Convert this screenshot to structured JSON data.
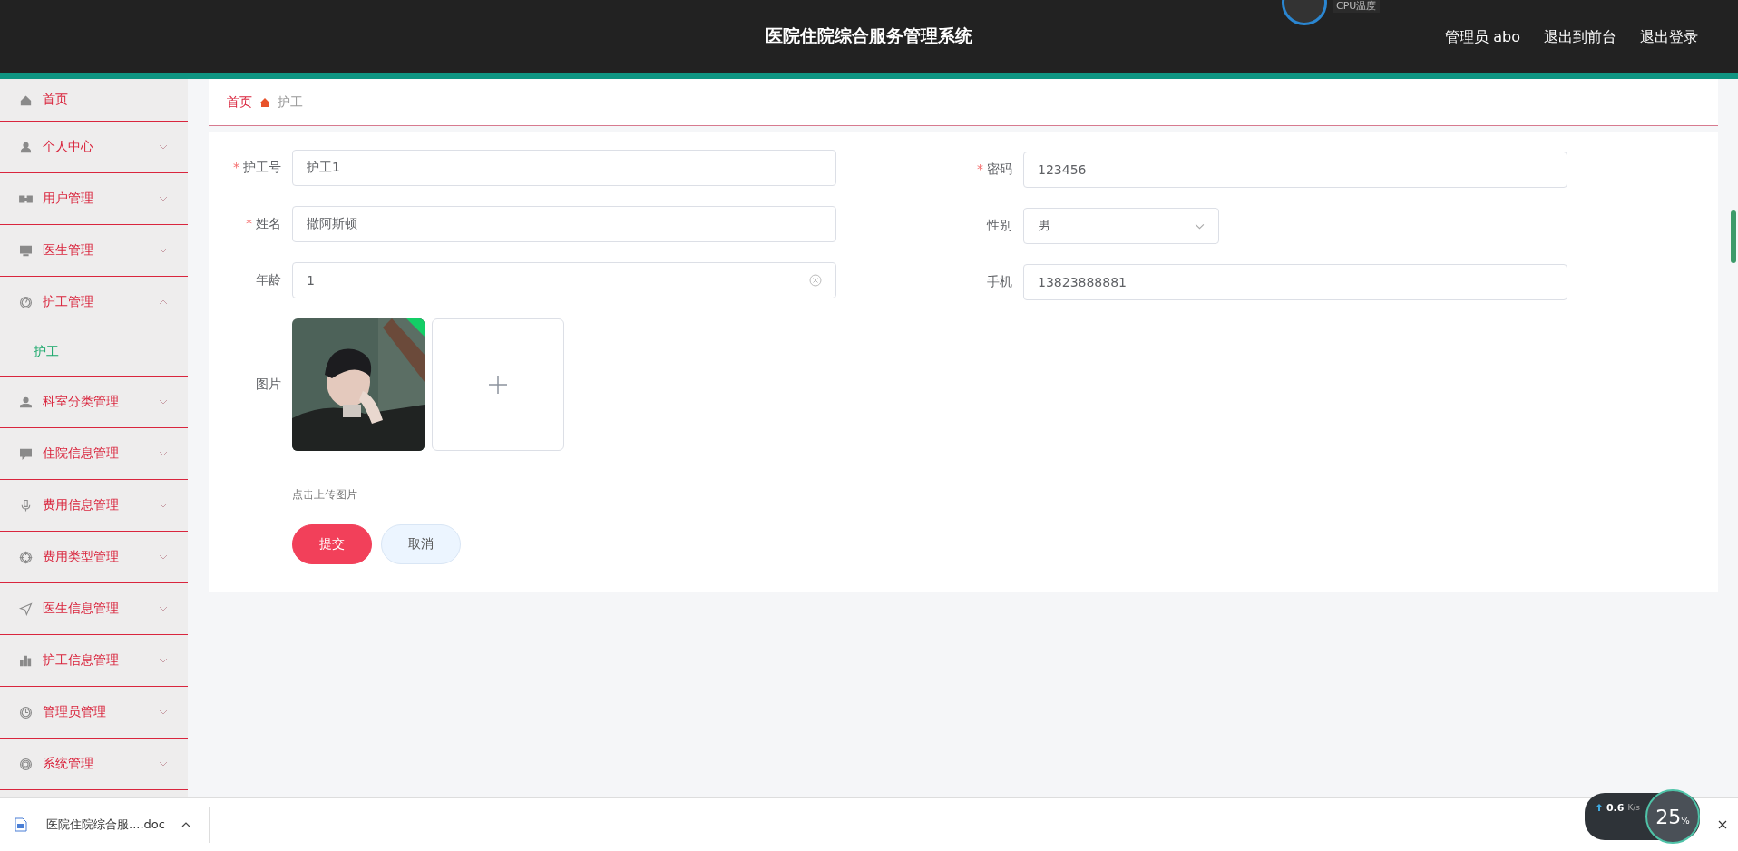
{
  "header": {
    "title": "医院住院综合服务管理系统",
    "user": "管理员 abo",
    "links": [
      "退出到前台",
      "退出登录"
    ],
    "cpu_widget": "CPU温度"
  },
  "sidebar": {
    "items": [
      {
        "label": "首页",
        "expandable": false
      },
      {
        "label": "个人中心",
        "expandable": true,
        "expanded": false
      },
      {
        "label": "用户管理",
        "expandable": true,
        "expanded": false
      },
      {
        "label": "医生管理",
        "expandable": true,
        "expanded": false
      },
      {
        "label": "护工管理",
        "expandable": true,
        "expanded": true,
        "children": [
          {
            "label": "护工",
            "selected": true
          }
        ]
      },
      {
        "label": "科室分类管理",
        "expandable": true,
        "expanded": false
      },
      {
        "label": "住院信息管理",
        "expandable": true,
        "expanded": false
      },
      {
        "label": "费用信息管理",
        "expandable": true,
        "expanded": false
      },
      {
        "label": "费用类型管理",
        "expandable": true,
        "expanded": false
      },
      {
        "label": "医生信息管理",
        "expandable": true,
        "expanded": false
      },
      {
        "label": "护工信息管理",
        "expandable": true,
        "expanded": false
      },
      {
        "label": "管理员管理",
        "expandable": true,
        "expanded": false
      },
      {
        "label": "系统管理",
        "expandable": true,
        "expanded": false
      }
    ]
  },
  "breadcrumb": [
    "首页",
    "护工"
  ],
  "form": {
    "left": [
      {
        "label": "护工号",
        "required_mark": "*",
        "kind": "text",
        "value": "护工1"
      },
      {
        "label": "姓名",
        "required_mark": "*",
        "kind": "text",
        "value": "撒阿斯顿"
      },
      {
        "label": "年龄",
        "kind": "clearable",
        "value": "1"
      }
    ],
    "right": [
      {
        "label": "密码",
        "required_mark": "*",
        "kind": "text",
        "value": "123456"
      },
      {
        "label": "性别",
        "kind": "select",
        "value": "男"
      },
      {
        "label": "手机",
        "kind": "text",
        "value": "13823888881"
      }
    ],
    "image": {
      "label": "图片",
      "uploaded": true,
      "hint": "点击上传图片"
    },
    "buttons": [
      {
        "label": "提交",
        "kind": "primary"
      },
      {
        "label": "取消",
        "kind": "secondary"
      }
    ]
  },
  "downloads": {
    "file": "医院住院综合服....doc"
  },
  "net_widget": {
    "upload": "0.6",
    "unit": "K/s",
    "percent": "25",
    "percent_sign": "%"
  }
}
